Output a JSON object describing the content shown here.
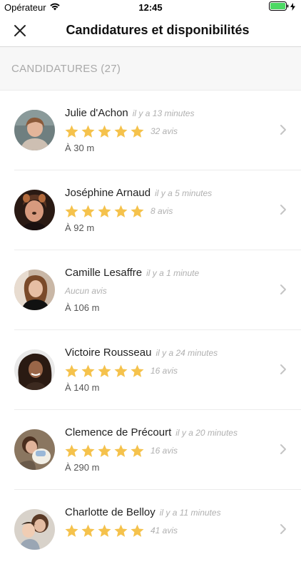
{
  "status_bar": {
    "carrier": "Opérateur",
    "time": "12:45"
  },
  "nav": {
    "title": "Candidatures et disponibilités"
  },
  "section": {
    "title": "CANDIDATURES (27)"
  },
  "colors": {
    "star": "#f5c24c",
    "accent_text": "#222222",
    "muted": "#b0b0b0",
    "battery": "#4cd964"
  },
  "candidates": [
    {
      "name": "Julie d'Achon",
      "time": "il y a 13 minutes",
      "rating": 5,
      "reviews": "32 avis",
      "distance": "À 30 m"
    },
    {
      "name": "Joséphine Arnaud",
      "time": "il y a 5 minutes",
      "rating": 5,
      "reviews": "8 avis",
      "distance": "À 92 m"
    },
    {
      "name": "Camille Lesaffre",
      "time": "il y a 1 minute",
      "rating": 0,
      "reviews": "Aucun avis",
      "distance": "À 106 m"
    },
    {
      "name": "Victoire Rousseau",
      "time": "il y a 24 minutes",
      "rating": 5,
      "reviews": "16 avis",
      "distance": "À 140 m"
    },
    {
      "name": "Clemence de Précourt",
      "time": "il y a 20 minutes",
      "rating": 5,
      "reviews": "16 avis",
      "distance": "À 290 m"
    },
    {
      "name": "Charlotte de Belloy",
      "time": "il y a 11 minutes",
      "rating": 5,
      "reviews": "41 avis",
      "distance": ""
    }
  ]
}
